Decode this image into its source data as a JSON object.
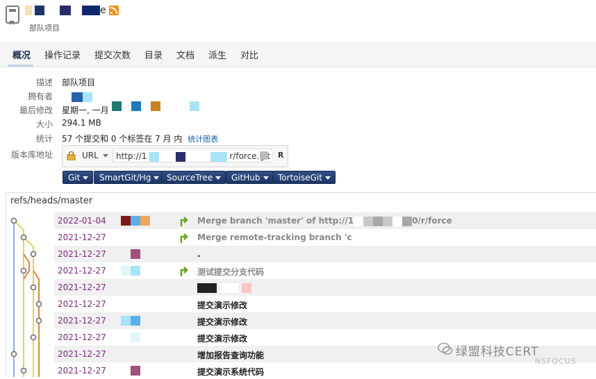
{
  "header": {
    "subtitle": "部队项目",
    "title_suffix": "e"
  },
  "tabs": [
    {
      "label": "概况",
      "active": true
    },
    {
      "label": "操作记录"
    },
    {
      "label": "提交次数"
    },
    {
      "label": "目录"
    },
    {
      "label": "文档"
    },
    {
      "label": "派生"
    },
    {
      "label": "对比"
    }
  ],
  "summary": {
    "description_label": "描述",
    "description": "部队项目",
    "owner_label": "拥有者",
    "last_modified_label": "最后修改",
    "last_modified": "星期一, 一月",
    "size_label": "大小",
    "size": "294.1 MB",
    "stats_label": "统计",
    "stats": "57 个提交和 0 个标签在 7 月 内",
    "stats_link": "统计图表",
    "repo_url_label": "版本库地址"
  },
  "url_box": {
    "protocol": "URL",
    "url_prefix": "http://1",
    "url_suffix": "r/force.git",
    "extra": "R"
  },
  "clients": [
    "Git",
    "SmartGit/Hg",
    "SourceTree",
    "GitHub",
    "TortoiseGit"
  ],
  "log": {
    "header": "refs/heads/master",
    "commits": [
      {
        "date": "2022-01-04",
        "message": "Merge branch 'master' of http://1",
        "message_tail": "0/r/force",
        "merge": true
      },
      {
        "date": "2021-12-27",
        "message": "Merge remote-tracking branch 'c",
        "merge": true
      },
      {
        "date": "2021-12-27",
        "message": "."
      },
      {
        "date": "2021-12-27",
        "message": "测试提交分支代码",
        "merge": true
      },
      {
        "date": "2021-12-27",
        "message": ""
      },
      {
        "date": "2021-12-27",
        "message": "提交演示修改"
      },
      {
        "date": "2021-12-27",
        "message": "提交演示修改"
      },
      {
        "date": "2021-12-27",
        "message": "提交演示修改"
      },
      {
        "date": "2021-12-27",
        "message": "增加报告查询功能"
      },
      {
        "date": "2021-12-27",
        "message": "提交演示系统代码"
      }
    ]
  },
  "watermark": {
    "text": "绿盟科技CERT",
    "sub": "NSFOCUS"
  },
  "colors": {
    "nav_bg": "#f5f5f5",
    "button_bg": "#1c3663",
    "date_color": "#7a2a7a",
    "link": "#1a5ea8"
  }
}
